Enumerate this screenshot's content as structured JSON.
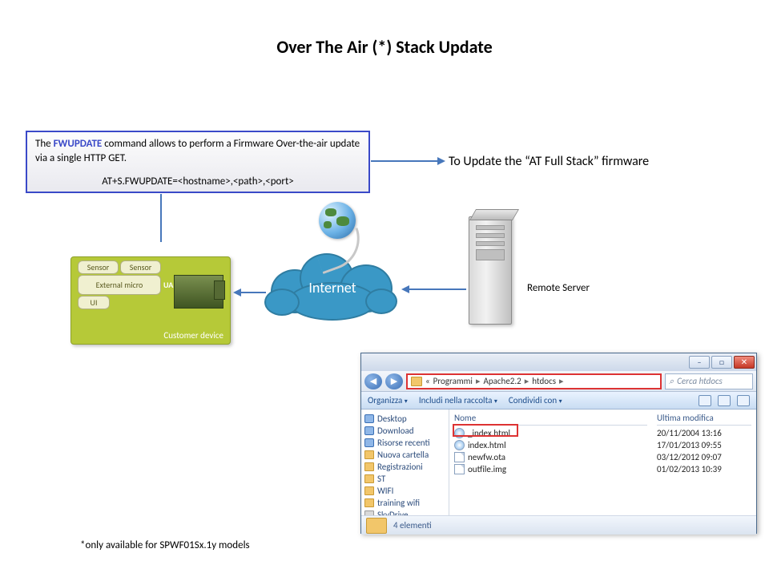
{
  "title": "Over The Air (*) Stack Update",
  "infobox": {
    "prefix": "The ",
    "cmd": "FWUPDATE",
    "rest": " command allows to perform a Firmware Over-the-air update via a single HTTP GET.",
    "syntax": "AT+S.FWUPDATE=<hostname>,<path>,<port>"
  },
  "update_label": "To Update the “AT Full Stack” firmware",
  "device": {
    "sensor": "Sensor",
    "external_micro": "External micro",
    "ui": "UI",
    "uart": "UART",
    "caption": "Customer device"
  },
  "cloud_label": "Internet",
  "server_label": "Remote Server",
  "explorer": {
    "breadcrumb": {
      "b0": "«",
      "b1": "Programmi",
      "b2": "Apache2.2",
      "b3": "htdocs",
      "sep": "▸"
    },
    "search_placeholder": "Cerca htdocs",
    "toolbar": {
      "org": "Organizza",
      "incl": "Includi nella raccolta",
      "share": "Condividi con",
      "tri": "▾"
    },
    "tree": [
      "Desktop",
      "Download",
      "Risorse recenti",
      "Nuova cartella",
      "Registrazioni",
      "ST",
      "WIFI",
      "training wifi",
      "SkyDrive"
    ],
    "col_name": "Nome",
    "col_date": "Ultima modifica",
    "files": [
      {
        "name": "_index.html",
        "date": "20/11/2004 13:16",
        "type": "ie"
      },
      {
        "name": "index.html",
        "date": "17/01/2013 09:55",
        "type": "ie"
      },
      {
        "name": "newfw.ota",
        "date": "03/12/2012 09:07",
        "type": "doc"
      },
      {
        "name": "outfile.img",
        "date": "01/02/2013 10:39",
        "type": "doc"
      }
    ],
    "status": "4 elementi",
    "btn_min": "–",
    "btn_max": "□",
    "btn_close": "✕",
    "nav_back": "◀",
    "nav_fwd": "▶",
    "search_icon": "⌕"
  },
  "footnote": "*only available for SPWF01Sx.1y models"
}
